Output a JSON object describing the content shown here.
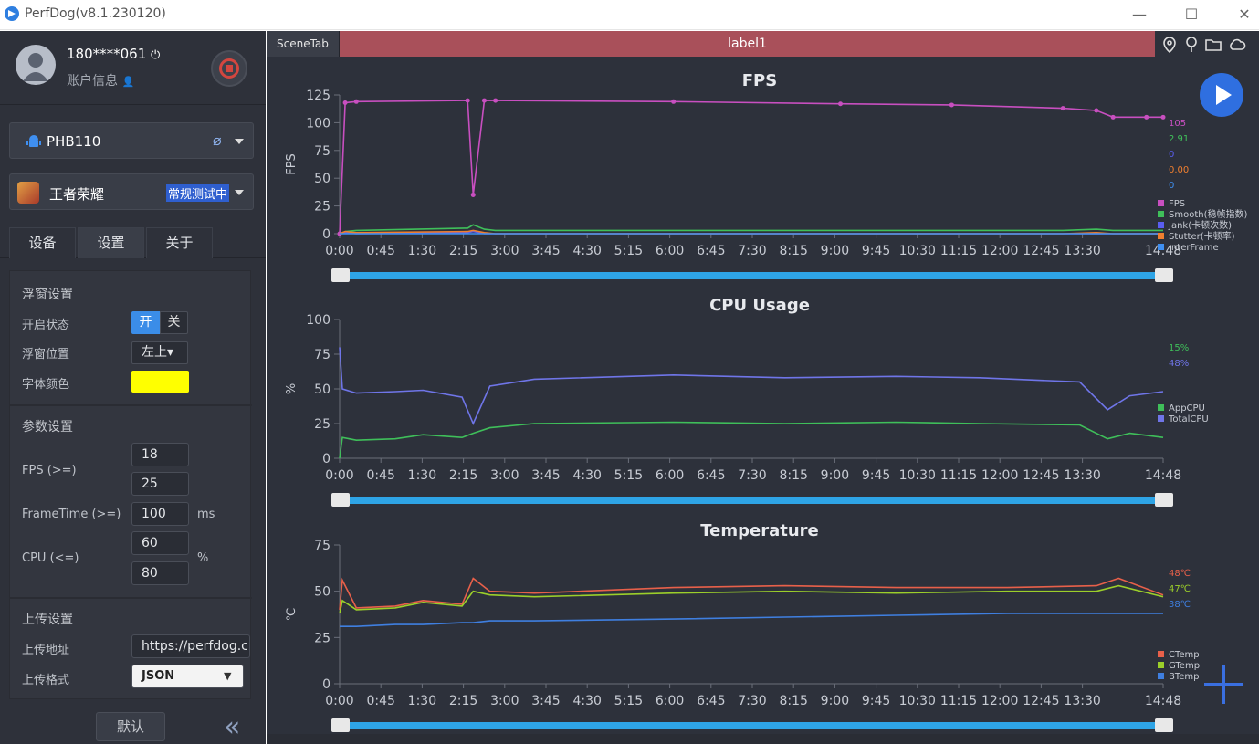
{
  "window": {
    "title": "PerfDog(v8.1.230120)",
    "minimize": "—",
    "maximize": "☐",
    "close": "✕"
  },
  "user": {
    "name": "180****061",
    "info_label": "账户信息"
  },
  "device": {
    "name": "PHB110"
  },
  "app": {
    "name": "王者荣耀",
    "mode": "常规测试中"
  },
  "tabs": [
    "设备",
    "设置",
    "关于"
  ],
  "settings": {
    "float_title": "浮窗设置",
    "open_state_label": "开启状态",
    "toggle_on": "开",
    "toggle_off": "关",
    "position_label": "浮窗位置",
    "position_value": "左上▾",
    "font_color_label": "字体颜色",
    "font_color": "#ffff00",
    "params_title": "参数设置",
    "fps_label": "FPS (>=)",
    "fps_values": [
      "18",
      "25"
    ],
    "frametime_label": "FrameTime (>=)",
    "frametime_value": "100",
    "frametime_unit": "ms",
    "cpu_label": "CPU (<=)",
    "cpu_values": [
      "60",
      "80"
    ],
    "cpu_unit": "%",
    "upload_title": "上传设置",
    "upload_addr_label": "上传地址",
    "upload_addr_value": "https://perfdog.c",
    "upload_format_label": "上传格式",
    "upload_format_value": "JSON",
    "default_button": "默认",
    "collapse": "«"
  },
  "scene_tab": "SceneTab",
  "label_tab": "label1",
  "colors": {
    "accent": "#2f6fe0",
    "label_tab": "#a9505a",
    "slider": "#2ea4e6"
  },
  "chart_data": [
    {
      "type": "line",
      "title": "FPS",
      "ylabel": "FPS",
      "ylim": [
        0,
        125
      ],
      "yticks": [
        0,
        25,
        50,
        75,
        100,
        125
      ],
      "xticks": [
        "0:00",
        "0:45",
        "1:30",
        "2:15",
        "3:00",
        "3:45",
        "4:30",
        "5:15",
        "6:00",
        "6:45",
        "7:30",
        "8:15",
        "9:00",
        "9:45",
        "10:30",
        "11:15",
        "12:00",
        "12:45",
        "13:30",
        "14:48"
      ],
      "x": [
        0,
        0.1,
        0.3,
        2.3,
        2.4,
        2.6,
        2.8,
        6,
        9,
        11,
        13,
        13.6,
        13.9,
        14.5,
        14.8
      ],
      "series": [
        {
          "name": "FPS",
          "color": "#c84fc0",
          "values": [
            0,
            118,
            119,
            120,
            35,
            120,
            120,
            119,
            117,
            116,
            113,
            111,
            105,
            105,
            105
          ]
        },
        {
          "name": "Smooth(稳帧指数)",
          "color": "#3fbf5a",
          "values": [
            0,
            2,
            3,
            5,
            8,
            4,
            3,
            3,
            3,
            3,
            3,
            4,
            3,
            3,
            3
          ]
        },
        {
          "name": "Jank(卡顿次数)",
          "color": "#5a5ef0",
          "values": [
            0,
            1,
            0,
            1,
            2,
            0,
            0,
            0,
            0,
            0,
            0,
            0,
            0,
            0,
            0
          ]
        },
        {
          "name": "Stutter(卡顿率)",
          "color": "#f07f2f",
          "values": [
            0,
            2,
            1,
            2,
            3,
            1,
            0,
            0,
            0,
            0,
            0,
            1,
            0,
            0,
            0
          ]
        },
        {
          "name": "InterFrame",
          "color": "#3f8ff0",
          "values": [
            0,
            0,
            0,
            0,
            0,
            0,
            0,
            0,
            0,
            0,
            0,
            0,
            0,
            0,
            0
          ]
        }
      ],
      "current_values": [
        "105",
        "2.91",
        "0",
        "0.00",
        "0"
      ]
    },
    {
      "type": "line",
      "title": "CPU Usage",
      "ylabel": "%",
      "ylim": [
        0,
        100
      ],
      "yticks": [
        0,
        25,
        50,
        75,
        100
      ],
      "xticks": [
        "0:00",
        "0:45",
        "1:30",
        "2:15",
        "3:00",
        "3:45",
        "4:30",
        "5:15",
        "6:00",
        "6:45",
        "7:30",
        "8:15",
        "9:00",
        "9:45",
        "10:30",
        "11:15",
        "12:00",
        "12:45",
        "13:30",
        "14:48"
      ],
      "x": [
        0,
        0.05,
        0.3,
        1.0,
        1.5,
        2.2,
        2.4,
        2.7,
        3.5,
        6,
        8,
        10,
        11.5,
        13.3,
        13.8,
        14.2,
        14.8
      ],
      "series": [
        {
          "name": "AppCPU",
          "color": "#3fbf5a",
          "values": [
            0,
            15,
            13,
            14,
            17,
            15,
            18,
            22,
            25,
            26,
            25,
            26,
            25,
            24,
            14,
            18,
            15
          ]
        },
        {
          "name": "TotalCPU",
          "color": "#6f75e8",
          "values": [
            80,
            50,
            47,
            48,
            49,
            44,
            25,
            52,
            57,
            60,
            58,
            59,
            58,
            55,
            35,
            45,
            48
          ]
        }
      ],
      "current_values": [
        "15%",
        "48%"
      ]
    },
    {
      "type": "line",
      "title": "Temperature",
      "ylabel": "℃",
      "ylim": [
        0,
        75
      ],
      "yticks": [
        0,
        25,
        50,
        75
      ],
      "xticks": [
        "0:00",
        "0:45",
        "1:30",
        "2:15",
        "3:00",
        "3:45",
        "4:30",
        "5:15",
        "6:00",
        "6:45",
        "7:30",
        "8:15",
        "9:00",
        "9:45",
        "10:30",
        "11:15",
        "12:00",
        "12:45",
        "13:30",
        "14:48"
      ],
      "x": [
        0,
        0.05,
        0.3,
        1.0,
        1.5,
        2.2,
        2.4,
        2.7,
        3.5,
        6,
        8,
        10,
        12,
        13.6,
        14.0,
        14.8
      ],
      "series": [
        {
          "name": "CTemp",
          "color": "#e8604a",
          "values": [
            40,
            56,
            41,
            42,
            45,
            43,
            57,
            50,
            49,
            52,
            53,
            52,
            52,
            53,
            57,
            48
          ]
        },
        {
          "name": "GTemp",
          "color": "#9ccf2a",
          "values": [
            38,
            45,
            40,
            41,
            44,
            42,
            50,
            48,
            47,
            49,
            50,
            49,
            50,
            50,
            53,
            47
          ]
        },
        {
          "name": "BTemp",
          "color": "#3f7fe0",
          "values": [
            31,
            31,
            31,
            32,
            32,
            33,
            33,
            34,
            34,
            35,
            36,
            37,
            38,
            38,
            38,
            38
          ]
        }
      ],
      "current_values": [
        "48℃",
        "47℃",
        "38℃"
      ]
    }
  ]
}
